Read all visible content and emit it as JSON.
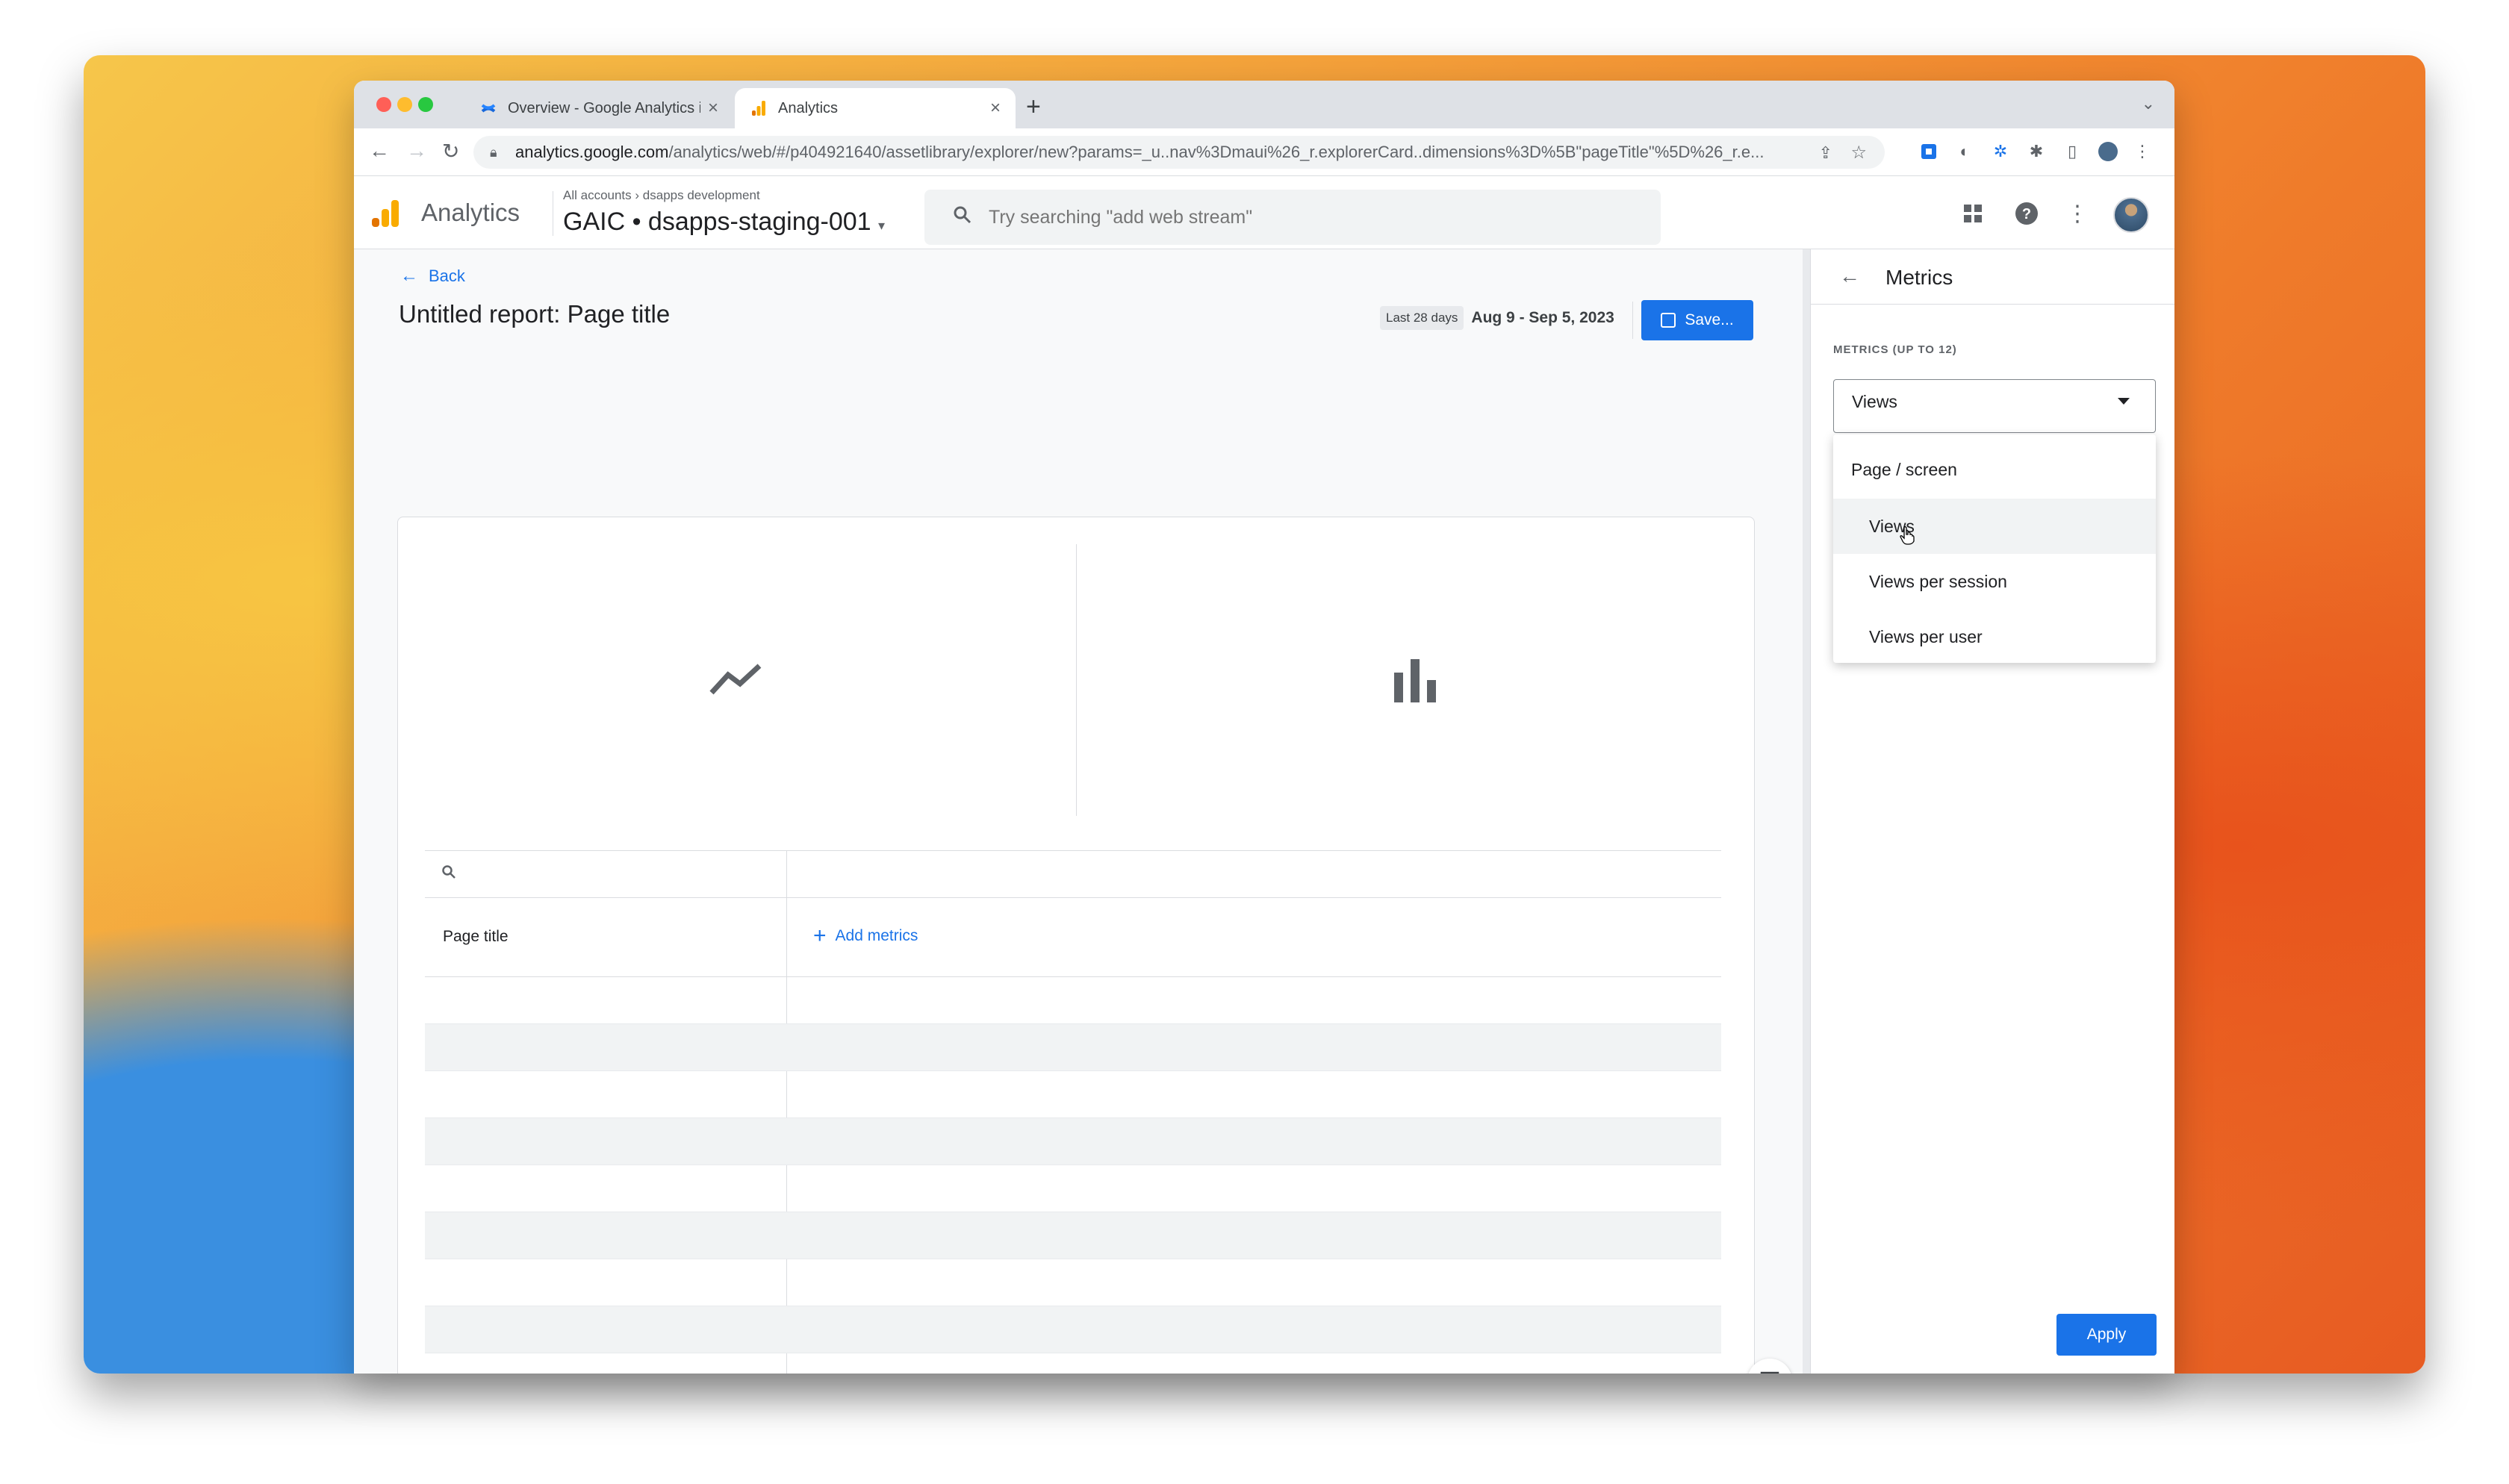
{
  "browser": {
    "tabs": [
      {
        "title": "Overview - Google Analytics in",
        "active": false
      },
      {
        "title": "Analytics",
        "active": true
      }
    ],
    "url_host": "analytics.google.com",
    "url_path": "/analytics/web/#/p404921640/assetlibrary/explorer/new?params=_u..nav%3Dmaui%26_r.explorerCard..dimensions%3D%5B\"pageTitle\"%5D%26_r.e..."
  },
  "header": {
    "app_name": "Analytics",
    "breadcrumb_root": "All accounts",
    "breadcrumb_account": "dsapps development",
    "property": "GAIC • dsapps-staging-001",
    "search_placeholder": "Try searching \"add web stream\""
  },
  "report": {
    "back_label": "Back",
    "title": "Untitled report: Page title",
    "date_short": "Last 28 days",
    "date_range": "Aug 9 - Sep 5, 2023",
    "save_label": "Save...",
    "table": {
      "dimension_header": "Page title",
      "add_metrics_label": "Add metrics"
    }
  },
  "panel": {
    "title": "Metrics",
    "metrics_label": "METRICS (UP TO 12)",
    "selected_value": "Views",
    "dropdown": {
      "group": "Page / screen",
      "options": [
        "Views",
        "Views per session",
        "Views per user"
      ]
    },
    "apply_label": "Apply"
  }
}
